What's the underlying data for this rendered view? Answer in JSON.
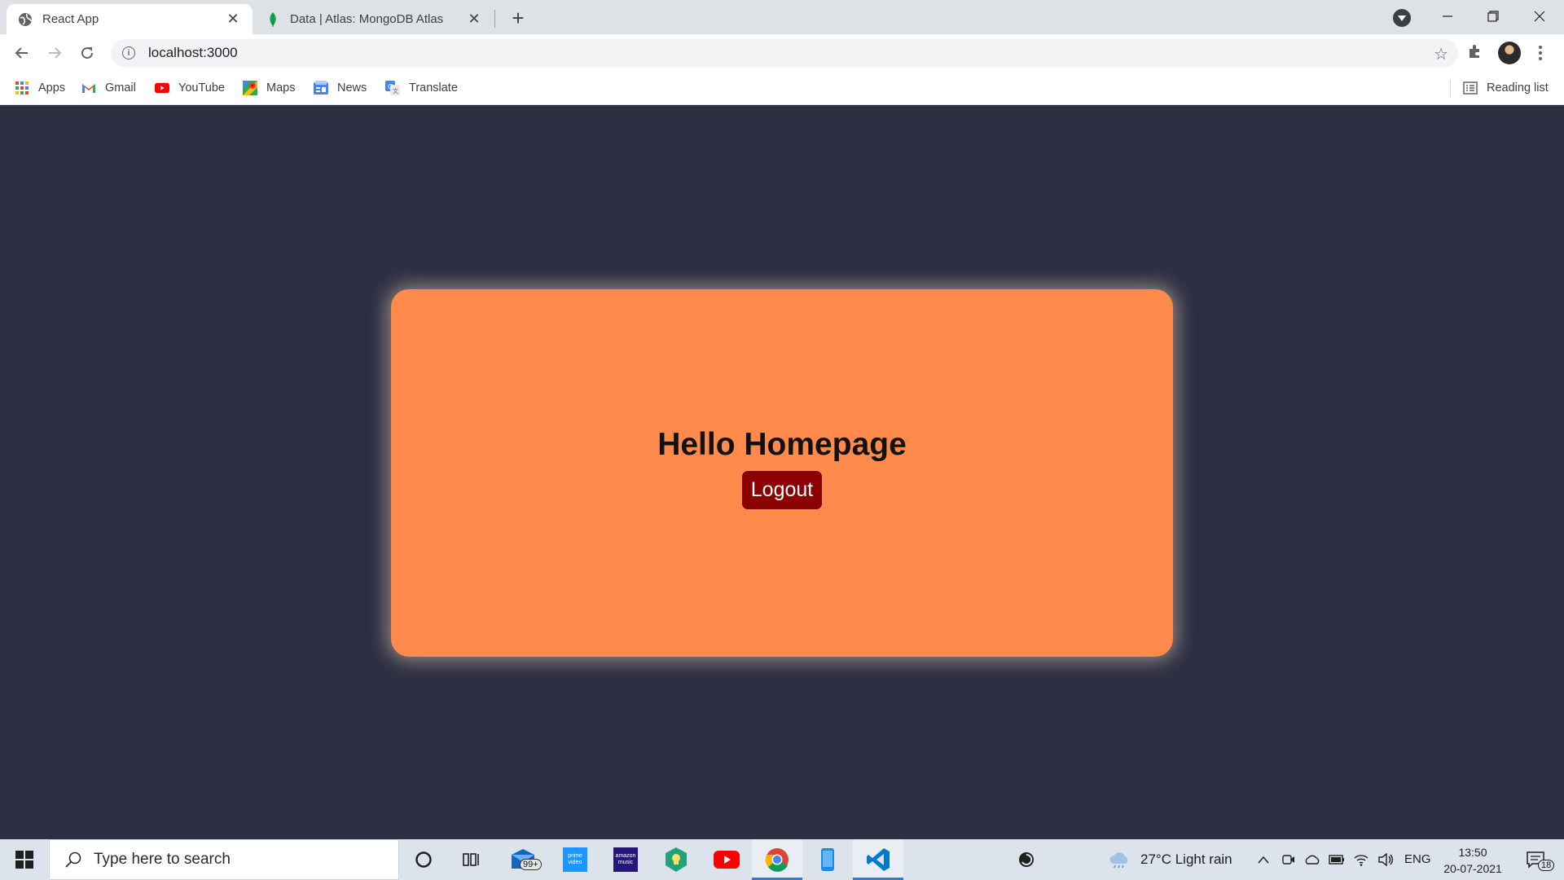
{
  "browser": {
    "tabs": [
      {
        "title": "React App",
        "active": true,
        "favicon": "globe-icon"
      },
      {
        "title": "Data | Atlas: MongoDB Atlas",
        "active": false,
        "favicon": "mongodb-leaf-icon"
      }
    ],
    "address": {
      "url": "localhost:3000"
    },
    "bookmarks": [
      {
        "label": "Apps",
        "icon": "apps-grid-icon"
      },
      {
        "label": "Gmail",
        "icon": "gmail-icon"
      },
      {
        "label": "YouTube",
        "icon": "youtube-icon"
      },
      {
        "label": "Maps",
        "icon": "maps-icon"
      },
      {
        "label": "News",
        "icon": "news-icon"
      },
      {
        "label": "Translate",
        "icon": "translate-icon"
      }
    ],
    "reading_list": "Reading list"
  },
  "page": {
    "heading": "Hello Homepage",
    "logout_label": "Logout",
    "background_color": "#2d2f43",
    "card_color": "#ff8a4c",
    "button_color": "#8b0000"
  },
  "taskbar": {
    "search_placeholder": "Type here to search",
    "mail_badge": "99+",
    "amazon_music_label": "amazon music",
    "prime_video_label": "prime video",
    "weather": "27°C  Light rain",
    "language": "ENG",
    "time": "13:50",
    "date": "20-07-2021",
    "notification_count": "18"
  }
}
